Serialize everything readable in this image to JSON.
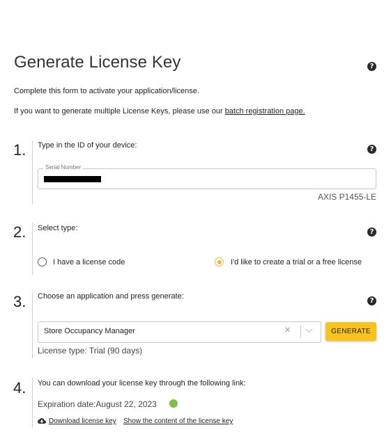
{
  "page": {
    "title": "Generate License Key",
    "intro": "Complete this form to activate your application/license.",
    "multi_prefix": "If you want to generate multiple License Keys, please use our ",
    "multi_link": "batch registration page."
  },
  "steps": {
    "step1": {
      "number": "1.",
      "label": "Type in the ID of your device:",
      "field_label": "Serial Number",
      "field_value": "XXXXXXXXXX",
      "model": "AXIS P1455-LE"
    },
    "step2": {
      "number": "2.",
      "label": "Select type:",
      "option1": "I have a license code",
      "option2": "I'd like to create a trial or a free license",
      "selected": "option2"
    },
    "step3": {
      "number": "3.",
      "label": "Choose an application and press generate:",
      "selected_app": "Store Occupancy Manager",
      "clear_symbol": "×",
      "chevron_symbol": "⌵",
      "button": "GENERATE",
      "license_type": "License type: Trial (90 days)"
    },
    "step4": {
      "number": "4.",
      "label": "You can download your license key through the following link:",
      "expiration": "Expiration date:August 22, 2023",
      "download_link": "Download license key",
      "show_link": "Show the content of the license key"
    }
  },
  "help_symbol": "?",
  "colors": {
    "accent": "#f9c21c",
    "radio_selected": "#f5b82e",
    "status_ok": "#7bc144"
  },
  "icons": [
    "help-icon",
    "clear-icon",
    "chevron-down-icon",
    "download-cloud-icon",
    "status-dot-icon"
  ]
}
